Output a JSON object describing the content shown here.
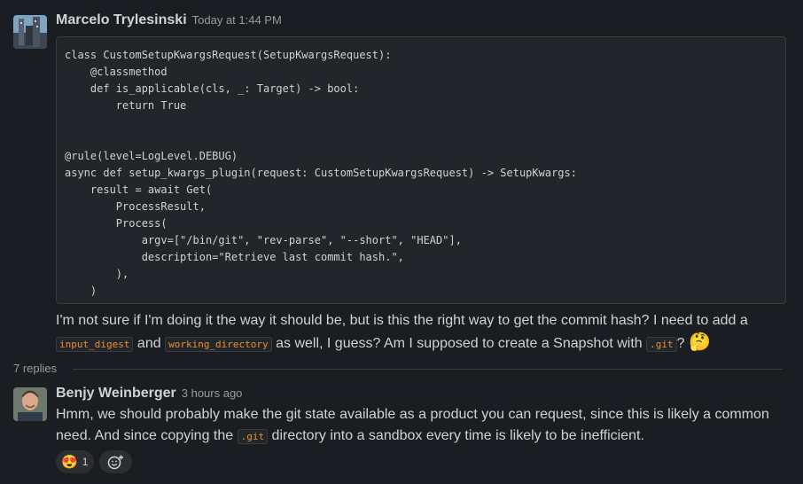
{
  "messages": [
    {
      "author": "Marcelo Trylesinski",
      "timestamp": "Today at 1:44 PM",
      "code": "class CustomSetupKwargsRequest(SetupKwargsRequest):\n    @classmethod\n    def is_applicable(cls, _: Target) -> bool:\n        return True\n\n\n@rule(level=LogLevel.DEBUG)\nasync def setup_kwargs_plugin(request: CustomSetupKwargsRequest) -> SetupKwargs:\n    result = await Get(\n        ProcessResult,\n        Process(\n            argv=[\"/bin/git\", \"rev-parse\", \"--short\", \"HEAD\"],\n            description=\"Retrieve last commit hash.\",\n        ),\n    )",
      "text_1": "I'm not sure if I'm doing it the way it should be, but is this the right way to get the commit hash? I need to add a ",
      "code_1": "input_digest",
      "text_2": " and ",
      "code_2": "working_directory",
      "text_3": " as well, I guess? Am I supposed to create a Snapshot with ",
      "code_3": ".git",
      "text_4": "?",
      "emoji": "🤔"
    },
    {
      "author": "Benjy Weinberger",
      "timestamp": "3 hours ago",
      "text_1": "Hmm, we should probably make the git state available as a product you can request, since this is likely a common need. And since copying the ",
      "code_1": ".git",
      "text_2": " directory into a sandbox every time is likely to be inefficient.",
      "reaction_emoji": "😍",
      "reaction_count": "1"
    }
  ],
  "thread": {
    "replies_label": "7 replies"
  },
  "icons": {
    "add_reaction": "add-reaction-icon"
  },
  "colors": {
    "background": "#1a1d21",
    "inline_code": "#e8912d",
    "code_bg": "#222529"
  }
}
